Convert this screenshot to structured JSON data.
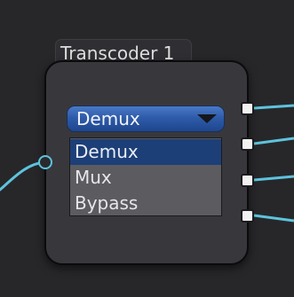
{
  "node": {
    "title": "Transcoder 1",
    "mode_dropdown": {
      "selected": "Demux",
      "options": [
        "Demux",
        "Mux",
        "Bypass"
      ]
    },
    "input_ports": 1,
    "output_ports": 4
  },
  "colors": {
    "canvas_background": "#27272a",
    "node_body": "#38383c",
    "wire": "#5ec3dd",
    "dropdown_accent": "#2d5aa8",
    "menu_highlight": "#1d3f78",
    "menu_background": "#5b5b60"
  }
}
